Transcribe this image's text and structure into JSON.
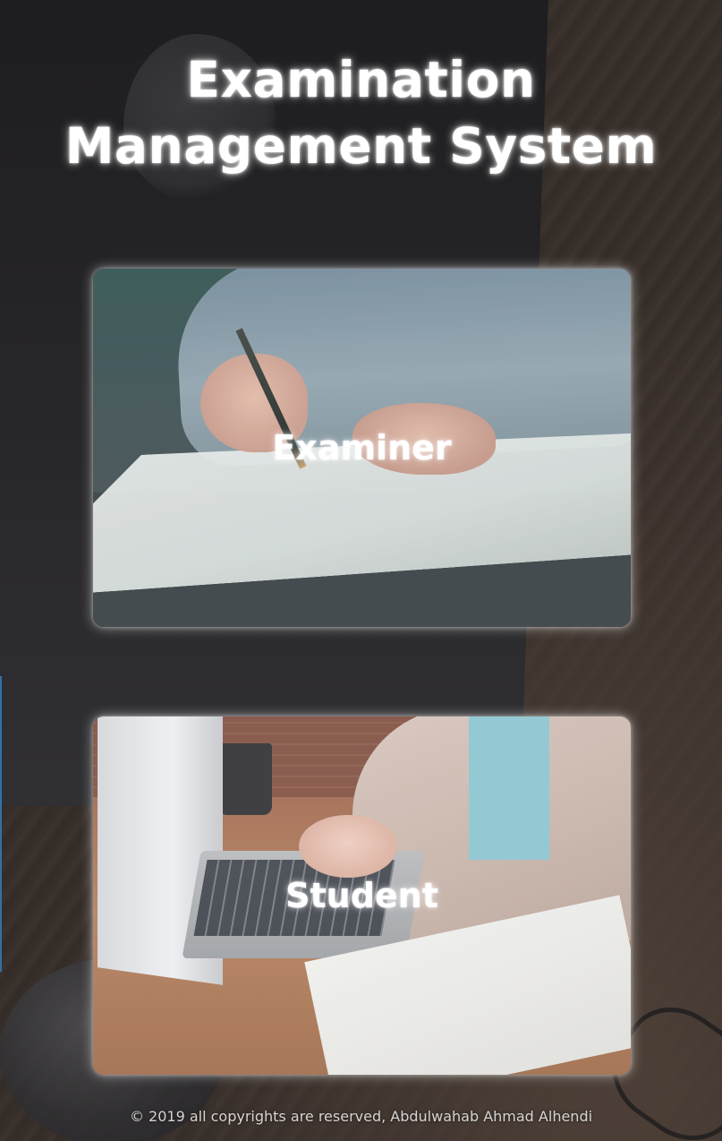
{
  "header": {
    "title_line1": "Examination",
    "title_line2": "Management System"
  },
  "cards": [
    {
      "label": "Examiner",
      "image": "person-writing-on-paper-photo"
    },
    {
      "label": "Student",
      "image": "person-typing-on-laptop-photo"
    }
  ],
  "footer": {
    "copyright": "© 2019 all copyrights are reserved, Abdulwahab Ahmad Alhendi"
  },
  "colors": {
    "title_text": "#ffffff",
    "card_glow": "#ffffff",
    "footer_text": "#d7d3d2"
  }
}
